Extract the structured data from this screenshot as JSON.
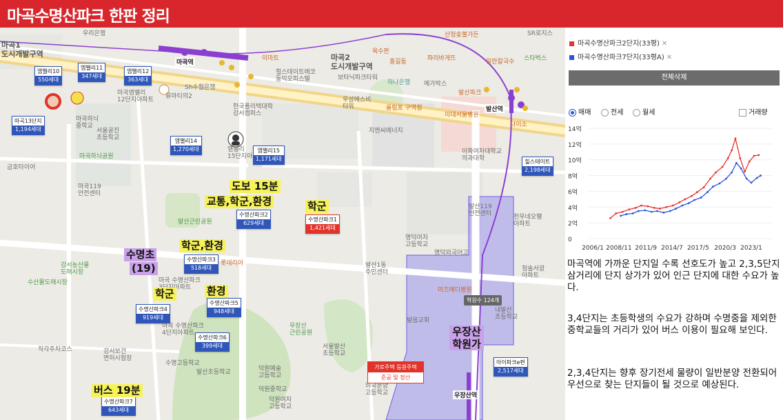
{
  "title": "마곡수명산파크 한판 정리",
  "legend": [
    {
      "label": "마곡수명산파크2단지(33평)",
      "color": "#e8322f",
      "remove": "✕"
    },
    {
      "label": "마곡수명산파크7단지(33평A)",
      "color": "#2a55d6",
      "remove": "✕"
    }
  ],
  "clear_all": "전체삭제",
  "trade_types": [
    "매매",
    "전세",
    "월세"
  ],
  "volume_label": "거래량",
  "chart_data": {
    "type": "line",
    "y_ticks": [
      "14억",
      "12억",
      "10억",
      "8억",
      "6억",
      "4억",
      "2억",
      "0"
    ],
    "x_ticks": [
      "2006/1",
      "2008/11",
      "2011/9",
      "2014/7",
      "2017/5",
      "2020/3",
      "2023/1"
    ],
    "ylim": [
      0,
      14
    ],
    "series": [
      {
        "name": "마곡수명산파크2단지(33평)",
        "color": "#e8322f",
        "x": [
          2007.9,
          2008.5,
          2009.2,
          2009.9,
          2010.6,
          2011.2,
          2011.9,
          2012.6,
          2013.2,
          2013.9,
          2014.6,
          2015.3,
          2015.9,
          2016.6,
          2017.2,
          2017.9,
          2018.6,
          2019.2,
          2019.9,
          2020.5,
          2020.9,
          2021.3,
          2021.8,
          2022.3,
          2022.8,
          2023.3,
          2023.8
        ],
        "values": [
          2.6,
          3.2,
          3.4,
          3.7,
          3.9,
          4.2,
          4.1,
          3.9,
          3.8,
          4.0,
          4.2,
          4.6,
          5.0,
          5.4,
          5.9,
          6.5,
          7.6,
          8.4,
          9.1,
          10.2,
          11.2,
          12.7,
          10.2,
          8.5,
          9.8,
          10.5,
          10.6
        ]
      },
      {
        "name": "마곡수명산파크7단지(33평A)",
        "color": "#2a55d6",
        "x": [
          2009.0,
          2009.6,
          2010.3,
          2010.9,
          2011.6,
          2012.3,
          2012.9,
          2013.6,
          2014.3,
          2014.9,
          2015.6,
          2016.3,
          2016.9,
          2017.6,
          2018.3,
          2018.9,
          2019.6,
          2020.3,
          2020.9,
          2021.4,
          2021.9,
          2022.5,
          2023.0,
          2023.6,
          2024.0
        ],
        "values": [
          2.9,
          3.1,
          3.2,
          3.5,
          3.6,
          3.4,
          3.5,
          3.3,
          3.5,
          3.8,
          4.2,
          4.5,
          4.9,
          5.2,
          5.9,
          6.6,
          7.0,
          7.6,
          8.4,
          9.6,
          8.9,
          7.6,
          7.1,
          7.7,
          8.0
        ]
      }
    ]
  },
  "notes": [
    "마곡역에 가까운 단지일 수록 선호도가 높고 2,3,5단지 삼거리에 단지 상가가 있어 인근 단지에 대한 수요가 높다.",
    "3,4단지는 초등학생의 수요가 강하며 수명중을 제외한 중학교들의 거리가 있어 버스 이용이 필요해 보인다.",
    "2,3,4단지는 향후 장기전세 물량이 일반분양 전환되어 우선으로 찾는 단지들이 될 것으로 예상된다."
  ],
  "map": {
    "badges": [
      {
        "name": "엠밸리10",
        "count": "550세대"
      },
      {
        "name": "엠밸리11",
        "count": "347세대"
      },
      {
        "name": "엠밸리12",
        "count": "363세대"
      },
      {
        "name": "마곡13단지",
        "count": "1,194세대"
      },
      {
        "name": "엠밸리14",
        "count": "1,270세대"
      },
      {
        "name": "엠밸리15",
        "count": "1,171세대"
      },
      {
        "name": "힐스테이트",
        "count": "2,198세대"
      },
      {
        "name": "수명산파크2",
        "count": "629세대"
      },
      {
        "name": "수명산파크1",
        "count": "1,421세대"
      },
      {
        "name": "수명산파크3",
        "count": "518세대"
      },
      {
        "name": "수명산파크4",
        "count": "919세대"
      },
      {
        "name": "수명산파크5",
        "count": "948세대"
      },
      {
        "name": "수명산파크6",
        "count": "399세대"
      },
      {
        "name": "수명산파크7",
        "count": "643세대"
      },
      {
        "name": "아이파크e편",
        "count": "2,517세대"
      }
    ],
    "highlights": [
      "도보 15분",
      "교통,학군,환경",
      "학군",
      "학군,환경",
      "수명초",
      "(19)",
      "학군",
      "환경",
      "버스 19분",
      "우장산",
      "학원가"
    ],
    "stations": [
      "마곡역",
      "발산역",
      "우장산역"
    ],
    "academy": "학원수 124개",
    "project": {
      "title": "가로주택 등원주택",
      "status": "준공 및 정산"
    },
    "districts": [
      "마곡1 도시개발구역",
      "마곡2 도시개발구역"
    ],
    "pois": [
      "우리은행",
      "마곡엠밸리 12단지아파트",
      "류마티의2",
      "Sh수협은행",
      "한국폴리텍대학 강서캠퍼스",
      "마곡하늬 중학교",
      "서울공진 초등학교",
      "마곡하늬공원",
      "마곡119 안전센터",
      "금호타이어",
      "엠밸리 15단지아파트",
      "발산근린공원",
      "강서농산물 도매시장",
      "수산물도매시장",
      "마곡 수명산파크 3단지아파트",
      "마곡 수명산파크 4단지아파트",
      "직각주차코스",
      "강서보건 면허시험장",
      "수명고등학교",
      "발산초등학교",
      "우장산 근린공원",
      "서울발산 초등학교",
      "덕원예술 고등학교",
      "덕원중학교",
      "덕원여자 고등학교",
      "하국분양 고등학교",
      "명덕여자 고등학교",
      "명덕외국어고",
      "발산1동 주민센터",
      "발음교회",
      "내발산 초등학교",
      "미즈메디병원",
      "이대서울병원",
      "이화여자대학교 의과대학",
      "발산119 안전센터",
      "천우네오팰 아파트",
      "청솔서광 아파트",
      "지엔씨에너지",
      "롯데리아",
      "힐스테이트에코 동익오피스텔",
      "보타닉파크타워",
      "하나은행",
      "메가박스",
      "발산파크",
      "스타벅스",
      "일란칼국수",
      "다이소",
      "육수판",
      "홍길동",
      "파리바게뜨",
      "SR로지스",
      "산청숯불가든",
      "우성에스비 타워",
      "올림포 구역점",
      "이마트"
    ]
  }
}
